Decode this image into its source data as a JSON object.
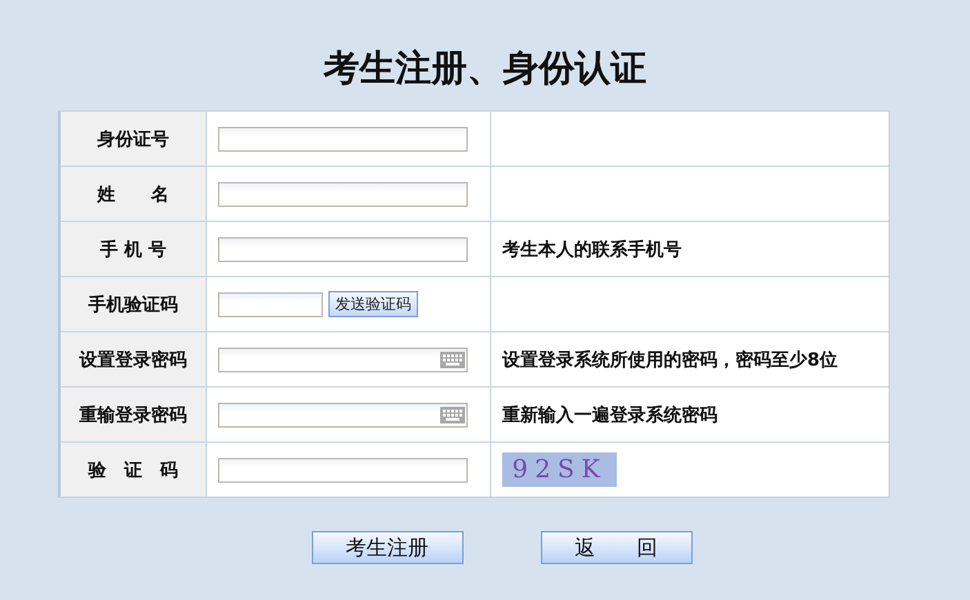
{
  "title": "考生注册、身份认证",
  "rows": [
    {
      "label": "身份证号",
      "kind": "text"
    },
    {
      "label": "姓　　名",
      "kind": "text"
    },
    {
      "label": "手 机 号",
      "kind": "text",
      "hint": "考生本人的联系手机号"
    },
    {
      "label": "手机验证码",
      "kind": "sms",
      "button": "发送验证码"
    },
    {
      "label": "设置登录密码",
      "kind": "password",
      "hint": "设置登录系统所使用的密码，密码至少8位"
    },
    {
      "label": "重输登录密码",
      "kind": "password",
      "hint": "重新输入一遍登录系统密码"
    },
    {
      "label": "验　证　码",
      "kind": "captcha",
      "captcha": "92SK"
    }
  ],
  "buttons": [
    "考生注册",
    "返　　回"
  ]
}
